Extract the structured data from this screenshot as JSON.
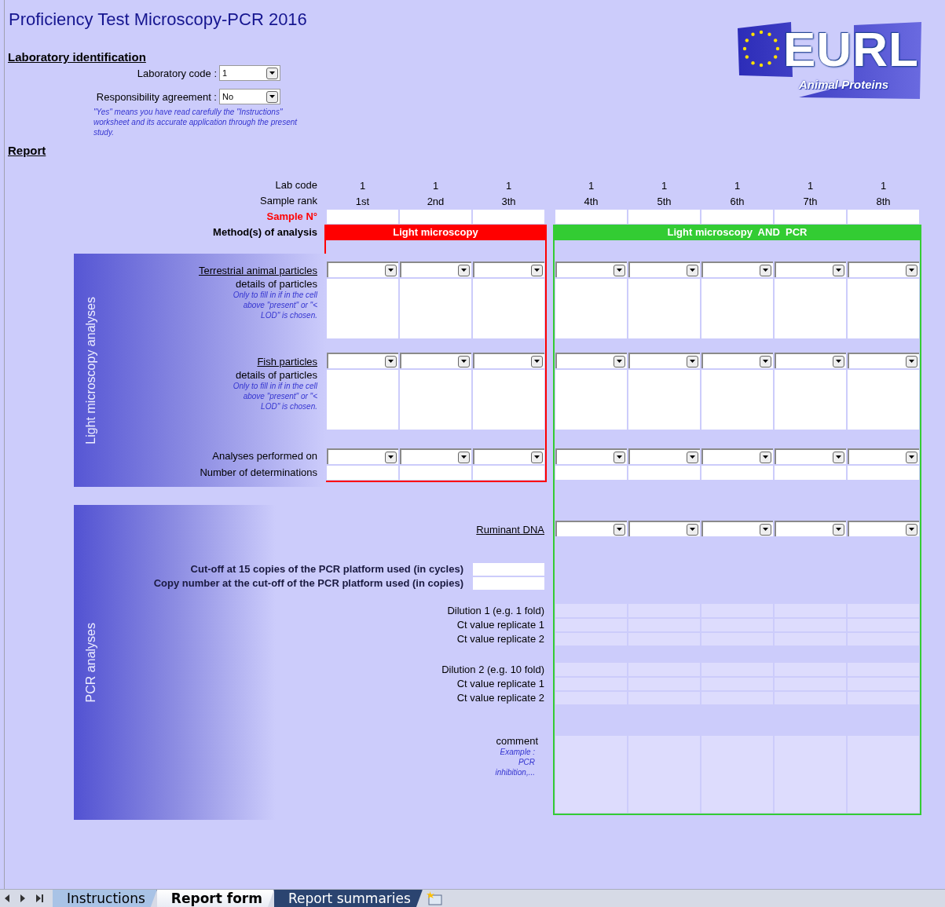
{
  "title": "Proficiency Test Microscopy-PCR 2016",
  "logo": {
    "text": "EURL",
    "subtitle": "Animal Proteins"
  },
  "lab_identification": {
    "heading": "Laboratory identification",
    "fields": [
      {
        "label": "Laboratory code :",
        "value": "1"
      },
      {
        "label": "Responsibility agreement :",
        "value": "No"
      }
    ],
    "note": "\"Yes\" means you have read carefully the \"Instructions\" worksheet and its accurate application through the present study."
  },
  "report": {
    "heading": "Report",
    "header_labels": {
      "lab_code": "Lab code",
      "sample_rank": "Sample rank",
      "sample_no": "Sample N°",
      "methods": "Method(s) of analysis"
    },
    "methods": [
      {
        "label": "Light microscopy",
        "color": "#ff0000",
        "includes_pcr": false,
        "samples": [
          {
            "lab_code": "1",
            "rank": "1st"
          },
          {
            "lab_code": "1",
            "rank": "2nd"
          },
          {
            "lab_code": "1",
            "rank": "3th"
          }
        ]
      },
      {
        "label": "Light microscopy  AND  PCR",
        "color": "#33cc33",
        "includes_pcr": true,
        "samples": [
          {
            "lab_code": "1",
            "rank": "4th"
          },
          {
            "lab_code": "1",
            "rank": "5th"
          },
          {
            "lab_code": "1",
            "rank": "6th"
          },
          {
            "lab_code": "1",
            "rank": "7th"
          },
          {
            "lab_code": "1",
            "rank": "8th"
          }
        ]
      }
    ],
    "light_microscopy": {
      "title": "Light microscopy analyses",
      "rows": [
        {
          "kind": "category",
          "label": "Terrestrial animal particles"
        },
        {
          "kind": "details",
          "label": "details of particles",
          "note": "Only to fill in if in the cell above \"present\" or \"< LOD\" is chosen."
        },
        {
          "kind": "category",
          "label": "Fish particles"
        },
        {
          "kind": "details",
          "label": "details of particles",
          "note": "Only to fill in if in the cell above \"present\" or \"< LOD\" is chosen."
        },
        {
          "kind": "dropdown",
          "label": "Analyses performed on"
        },
        {
          "kind": "count",
          "label": "Number of determinations"
        }
      ]
    },
    "pcr": {
      "title": "PCR analyses",
      "target": {
        "label": "Ruminant DNA"
      },
      "platform_fields": [
        {
          "label": "Cut-off at 15 copies of the PCR platform used (in cycles)"
        },
        {
          "label": "Copy number at the cut-off of the PCR platform used (in copies)"
        }
      ],
      "dilutions": [
        {
          "label": "Dilution 1 (e.g. 1 fold)",
          "replicates": [
            "Ct value replicate 1",
            "Ct value replicate 2"
          ]
        },
        {
          "label": "Dilution 2 (e.g. 10 fold)",
          "replicates": [
            "Ct value replicate 1",
            "Ct value replicate 2"
          ]
        }
      ],
      "comment": {
        "label": "comment",
        "note": "Example : PCR inhibition,..."
      }
    }
  },
  "sheet_tabs": [
    {
      "label": "Instructions",
      "selected": false,
      "color": "#a9c3e6"
    },
    {
      "label": "Report form",
      "selected": true
    },
    {
      "label": "Report summaries",
      "selected": false,
      "color": "#2b4470"
    }
  ]
}
